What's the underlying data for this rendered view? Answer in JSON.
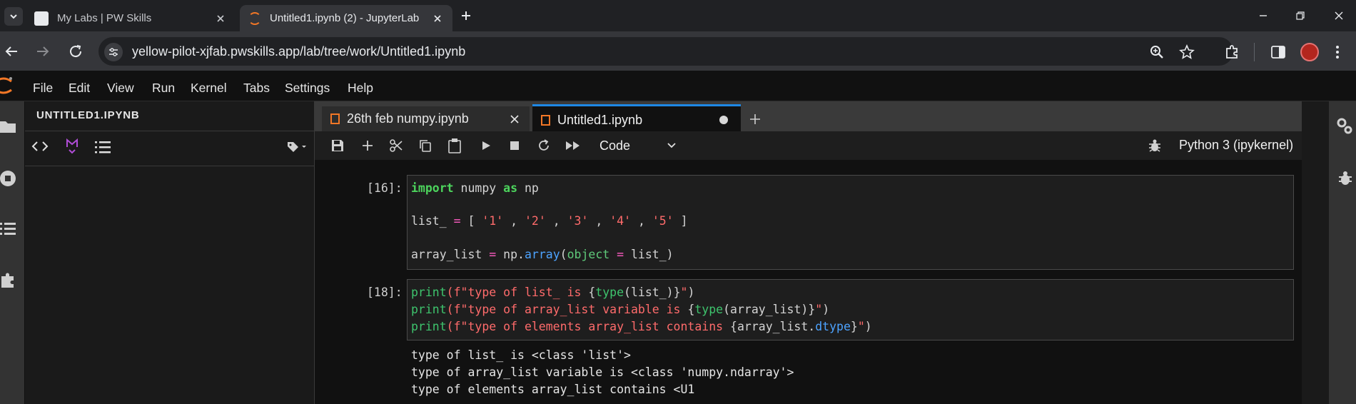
{
  "browser": {
    "tabs": [
      {
        "title": "My Labs | PW Skills"
      },
      {
        "title": "Untitled1.ipynb (2) - JupyterLab"
      }
    ],
    "url": "yellow-pilot-xjfab.pwskills.app/lab/tree/work/Untitled1.ipynb"
  },
  "jupyter": {
    "menu": [
      "File",
      "Edit",
      "View",
      "Run",
      "Kernel",
      "Tabs",
      "Settings",
      "Help"
    ],
    "left_panel_title": "UNTITLED1.IPYNB",
    "notebook_tabs": [
      {
        "title": "26th feb numpy.ipynb"
      },
      {
        "title": "Untitled1.ipynb"
      }
    ],
    "cell_type": "Code",
    "kernel": "Python 3 (ipykernel)"
  },
  "cells": [
    {
      "prompt": "[16]:",
      "lines": [
        "import numpy as np",
        "",
        "list_ = [ '1' , '2' , '3' , '4' , '5' ]",
        "",
        "array_list = np.array(object = list_)"
      ]
    },
    {
      "prompt": "[18]:",
      "lines": [
        "print(f\"type of list_ is {type(list_)}\")",
        "print(f\"type of array_list variable is {type(array_list)}\")",
        "print(f\"type of elements array_list contains {array_list.dtype}\")"
      ],
      "output": [
        "type of list_ is <class 'list'>",
        "type of array_list variable is <class 'numpy.ndarray'>",
        "type of elements array_list contains <U1"
      ]
    }
  ],
  "colors": {
    "accent_orange": "#f37726",
    "active_tab_underline": "#1e88e5",
    "keyword_green": "#4cd35c",
    "operator_pink": "#ff5cc3",
    "string_red": "#ff6b6b",
    "function_blue": "#4da3ff"
  }
}
